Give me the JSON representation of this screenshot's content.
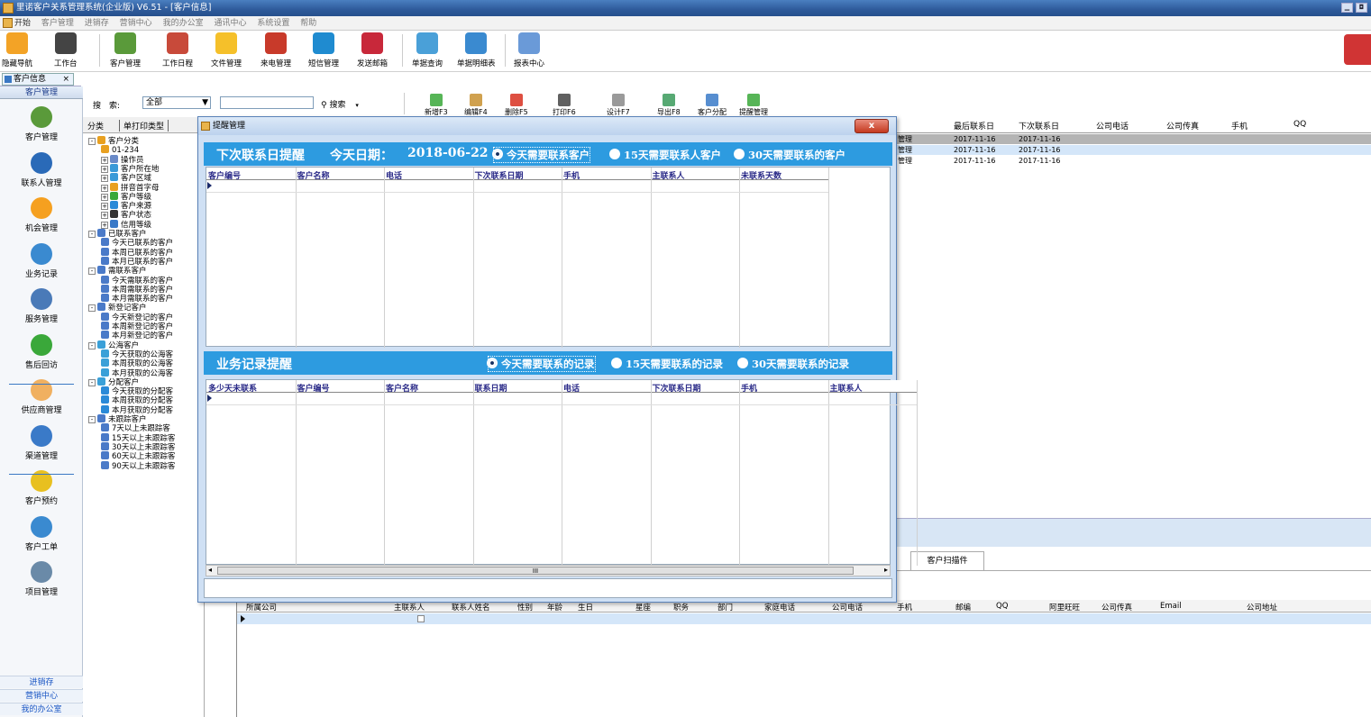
{
  "window": {
    "title": "里诺客户关系管理系统(企业版) V6.51 - [客户信息]"
  },
  "menu": [
    "开始",
    "客户管理",
    "进销存",
    "营销中心",
    "我的办公室",
    "通讯中心",
    "系统设置",
    "帮助"
  ],
  "toolbar": {
    "items": [
      {
        "label": "隐藏导航",
        "icon": "butterfly-icon",
        "color": "#f3a326"
      },
      {
        "label": "工作台",
        "icon": "globe-icon",
        "color": "#444444"
      },
      {
        "label": "客户管理",
        "icon": "users-icon",
        "color": "#5a9a3a"
      },
      {
        "label": "工作日程",
        "icon": "calendar-icon",
        "color": "#c84a3a"
      },
      {
        "label": "文件管理",
        "icon": "folder-icon",
        "color": "#f5c02a"
      },
      {
        "label": "来电管理",
        "icon": "phone-icon",
        "color": "#c83a2a"
      },
      {
        "label": "短信管理",
        "icon": "sms-icon",
        "color": "#1f8bd0"
      },
      {
        "label": "发送邮箱",
        "icon": "mail-icon",
        "color": "#c8283a"
      },
      {
        "label": "单据查询",
        "icon": "search-icon",
        "color": "#4aa0d8"
      },
      {
        "label": "单据明细表",
        "icon": "bar-chart-icon",
        "color": "#3a8ad0"
      },
      {
        "label": "报表中心",
        "icon": "report-icon",
        "color": "#6a9ad8"
      }
    ]
  },
  "doc_tab": {
    "label": "客户信息",
    "close": "×"
  },
  "left_nav": {
    "header": "客户管理",
    "items": [
      {
        "label": "客户管理",
        "icon": "users-icon",
        "color": "#5a9a3a"
      },
      {
        "label": "联系人管理",
        "icon": "contact-icon",
        "color": "#2a6ab8"
      },
      {
        "label": "机会管理",
        "icon": "star-icon",
        "color": "#f5a020"
      },
      {
        "label": "业务记录",
        "icon": "chart-icon",
        "color": "#3a8ad0"
      },
      {
        "label": "服务管理",
        "icon": "globe-icon",
        "color": "#4a7ab8"
      },
      {
        "label": "售后回访",
        "icon": "chat-icon",
        "color": "#3aa83a"
      },
      {
        "label": "供应商管理",
        "icon": "person-icon",
        "color": "#f0b060"
      },
      {
        "label": "渠道管理",
        "icon": "mail-icon",
        "color": "#3a7ac8"
      },
      {
        "label": "客户预约",
        "icon": "smiley-icon",
        "color": "#e8c020"
      },
      {
        "label": "客户工单",
        "icon": "clipboard-icon",
        "color": "#3a8ad0"
      },
      {
        "label": "项目管理",
        "icon": "presenter-icon",
        "color": "#6a8aa8"
      }
    ],
    "bottom": [
      "进销存",
      "营销中心",
      "我的办公室"
    ]
  },
  "search": {
    "label": "搜　索:",
    "scope": "全部",
    "query": "",
    "button": "搜索",
    "actions": [
      "新增F3",
      "编辑F4",
      "删除F5",
      "打印F6",
      "设计F7",
      "导出F8",
      "客户分配",
      "提醒管理"
    ]
  },
  "tree": {
    "tabs": [
      "分类",
      "单打印类型"
    ],
    "nodes": [
      {
        "text": "客户分类",
        "level": 0,
        "exp": "-",
        "color": "#e8a020"
      },
      {
        "text": "01-234",
        "level": 1,
        "color": "#e8a020"
      },
      {
        "text": "操作员",
        "level": 1,
        "exp": "+",
        "color": "#6a8ac8"
      },
      {
        "text": "客户所在地",
        "level": 1,
        "exp": "+",
        "color": "#3a9ad8"
      },
      {
        "text": "客户区域",
        "level": 1,
        "exp": "+",
        "color": "#3a9ad8"
      },
      {
        "text": "拼音首字母",
        "level": 1,
        "exp": "+",
        "color": "#e8a020"
      },
      {
        "text": "客户等级",
        "level": 1,
        "exp": "+",
        "color": "#3aa83a"
      },
      {
        "text": "客户来源",
        "level": 1,
        "exp": "+",
        "color": "#2a8ad8"
      },
      {
        "text": "客户状态",
        "level": 1,
        "exp": "+",
        "color": "#333333"
      },
      {
        "text": "信用等级",
        "level": 1,
        "exp": "+",
        "color": "#3a7ac8"
      },
      {
        "text": "已联系客户",
        "level": 0,
        "exp": "-",
        "color": "#4a7ac8"
      },
      {
        "text": "今天已联系的客户",
        "level": 1,
        "color": "#4a7ac8"
      },
      {
        "text": "本周已联系的客户",
        "level": 1,
        "color": "#4a7ac8"
      },
      {
        "text": "本月已联系的客户",
        "level": 1,
        "color": "#4a7ac8"
      },
      {
        "text": "需联系客户",
        "level": 0,
        "exp": "-",
        "color": "#4a7ac8"
      },
      {
        "text": "今天需联系的客户",
        "level": 1,
        "color": "#4a7ac8"
      },
      {
        "text": "本周需联系的客户",
        "level": 1,
        "color": "#4a7ac8"
      },
      {
        "text": "本月需联系的客户",
        "level": 1,
        "color": "#4a7ac8"
      },
      {
        "text": "新登记客户",
        "level": 0,
        "exp": "-",
        "color": "#4a7ac8"
      },
      {
        "text": "今天新登记的客户",
        "level": 1,
        "color": "#4a7ac8"
      },
      {
        "text": "本周新登记的客户",
        "level": 1,
        "color": "#4a7ac8"
      },
      {
        "text": "本月新登记的客户",
        "level": 1,
        "color": "#4a7ac8"
      },
      {
        "text": "公海客户",
        "level": 0,
        "exp": "-",
        "color": "#3aa0d8"
      },
      {
        "text": "今天获取的公海客",
        "level": 1,
        "color": "#3aa0d8"
      },
      {
        "text": "本周获取的公海客",
        "level": 1,
        "color": "#3aa0d8"
      },
      {
        "text": "本月获取的公海客",
        "level": 1,
        "color": "#3aa0d8"
      },
      {
        "text": "分配客户",
        "level": 0,
        "exp": "-",
        "color": "#3aa0d8"
      },
      {
        "text": "今天获取的分配客",
        "level": 1,
        "color": "#2a8ad8"
      },
      {
        "text": "本周获取的分配客",
        "level": 1,
        "color": "#2a8ad8"
      },
      {
        "text": "本月获取的分配客",
        "level": 1,
        "color": "#2a8ad8"
      },
      {
        "text": "未跟踪客户",
        "level": 0,
        "exp": "-",
        "color": "#4a7ac8"
      },
      {
        "text": "7天以上未跟踪客",
        "level": 1,
        "color": "#4a7ac8"
      },
      {
        "text": "15天以上未跟踪客",
        "level": 1,
        "color": "#4a7ac8"
      },
      {
        "text": "30天以上未跟踪客",
        "level": 1,
        "color": "#4a7ac8"
      },
      {
        "text": "60天以上未跟踪客",
        "level": 1,
        "color": "#4a7ac8"
      },
      {
        "text": "90天以上未跟踪客",
        "level": 1,
        "color": "#4a7ac8"
      }
    ]
  },
  "main_grid": {
    "columns": [
      "最后联系日",
      "下次联系日",
      "公司电话",
      "公司传真",
      "手机",
      "QQ"
    ],
    "rows": [
      {
        "lead": "管理",
        "last": "2017-11-16",
        "next": "2017-11-16"
      },
      {
        "lead": "管理",
        "last": "2017-11-16",
        "next": "2017-11-16"
      },
      {
        "lead": "管理",
        "last": "2017-11-16",
        "next": "2017-11-16"
      }
    ]
  },
  "detail": {
    "tab": "客户扫描件",
    "columns": [
      "所属公司",
      "主联系人",
      "联系人姓名",
      "性别",
      "年龄",
      "生日",
      "星座",
      "职务",
      "部门",
      "家庭电话",
      "公司电话",
      "手机",
      "邮编",
      "QQ",
      "阿里旺旺",
      "公司传真",
      "Email",
      "公司地址"
    ]
  },
  "dialog": {
    "title": "提醒管理",
    "close": "x",
    "next_contact": {
      "title": "下次联系日提醒",
      "today_label": "今天日期：",
      "today": "2018-06-22",
      "options": [
        "今天需要联系客户",
        "15天需要联系人客户",
        "30天需要联系的客户"
      ],
      "selected": 0,
      "columns": [
        "客户编号",
        "客户名称",
        "电话",
        "下次联系日期",
        "手机",
        "主联系人",
        "未联系天数"
      ]
    },
    "business": {
      "title": "业务记录提醒",
      "options": [
        "今天需要联系的记录",
        "15天需要联系的记录",
        "30天需要联系的记录"
      ],
      "selected": 0,
      "columns": [
        "多少天未联系",
        "客户编号",
        "客户名称",
        "联系日期",
        "电话",
        "下次联系日期",
        "手机",
        "主联系人"
      ]
    },
    "scroll_mark": "III"
  },
  "colors": {
    "accent": "#2d9be0",
    "title_blue": "#2e5a9a"
  }
}
